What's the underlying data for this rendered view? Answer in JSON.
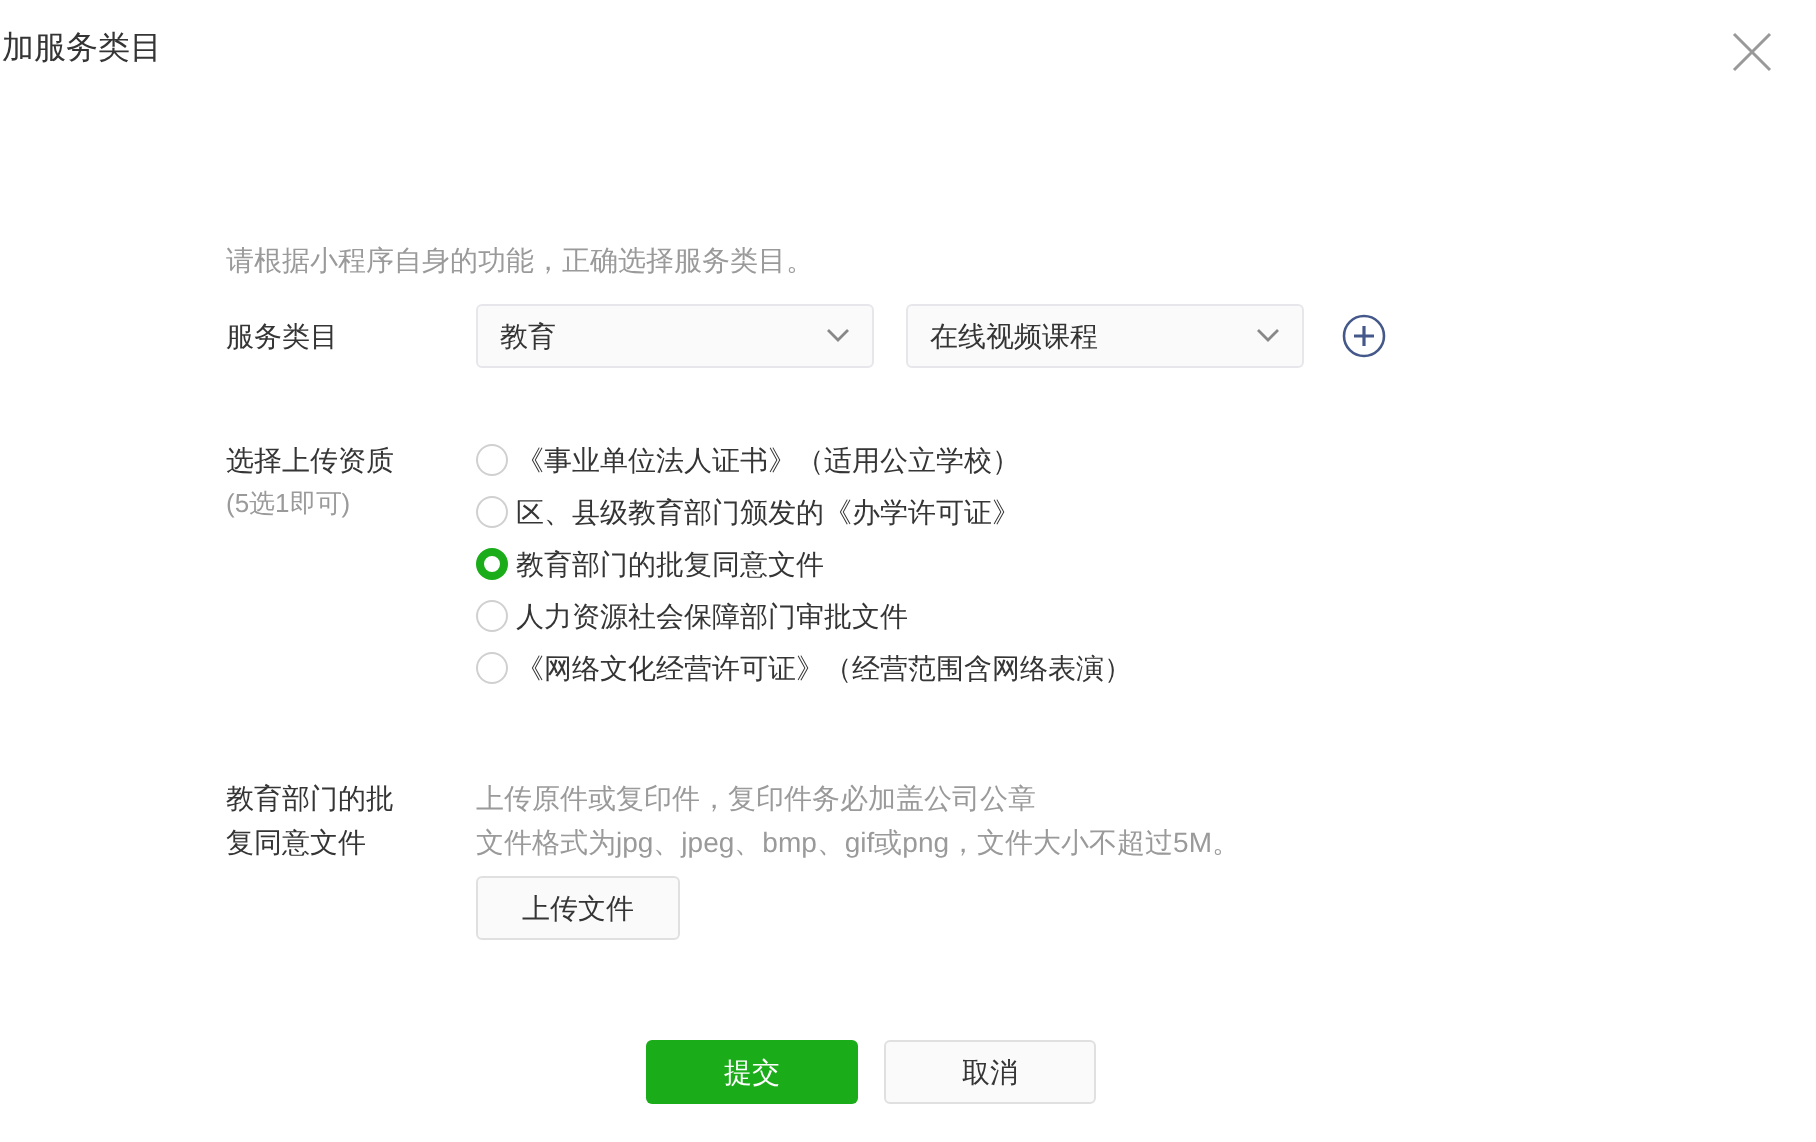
{
  "dialog": {
    "title": "加服务类目"
  },
  "intro": "请根据小程序自身的功能，正确选择服务类目。",
  "category": {
    "label": "服务类目",
    "selects": [
      {
        "value": "教育"
      },
      {
        "value": "在线视频课程"
      }
    ]
  },
  "qualification": {
    "label": "选择上传资质",
    "hint": "(5选1即可)",
    "options": [
      {
        "label": "《事业单位法人证书》（适用公立学校）",
        "selected": false
      },
      {
        "label": "区、县级教育部门颁发的《办学许可证》",
        "selected": false
      },
      {
        "label": "教育部门的批复同意文件",
        "selected": true
      },
      {
        "label": "人力资源社会保障部门审批文件",
        "selected": false
      },
      {
        "label": "《网络文化经营许可证》（经营范围含网络表演）",
        "selected": false
      }
    ]
  },
  "upload": {
    "label": "教育部门的批复同意文件",
    "notes": [
      "上传原件或复印件，复印件务必加盖公司公章",
      "文件格式为jpg、jpeg、bmp、gif或png，文件大小不超过5M。"
    ],
    "button": "上传文件"
  },
  "buttons": {
    "submit": "提交",
    "cancel": "取消"
  }
}
